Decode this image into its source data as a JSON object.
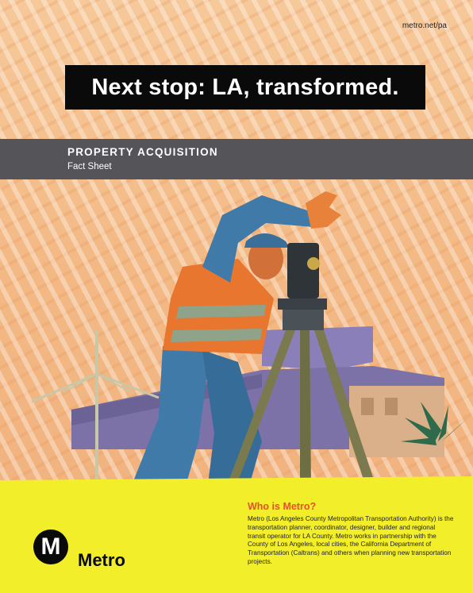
{
  "header": {
    "url": "metro.net/pa",
    "headline": "Next stop: LA, transformed."
  },
  "band": {
    "title": "PROPERTY ACQUISITION",
    "subtitle": "Fact Sheet"
  },
  "info": {
    "heading": "Who is Metro?",
    "body": "Metro (Los Angeles County Metropolitan Transportation Authority) is the transportation planner, coordinator, designer, builder and regional transit operator for LA County. Metro works in partnership with the County of Los Angeles, local cities, the California Department of Transportation (Caltrans) and others when planning new transportation projects."
  },
  "logo": {
    "letter": "M",
    "word": "Metro"
  },
  "colors": {
    "yellow": "#f2ee2a",
    "band": "#555559",
    "accent": "#e8502a",
    "vest": "#e8762e"
  }
}
